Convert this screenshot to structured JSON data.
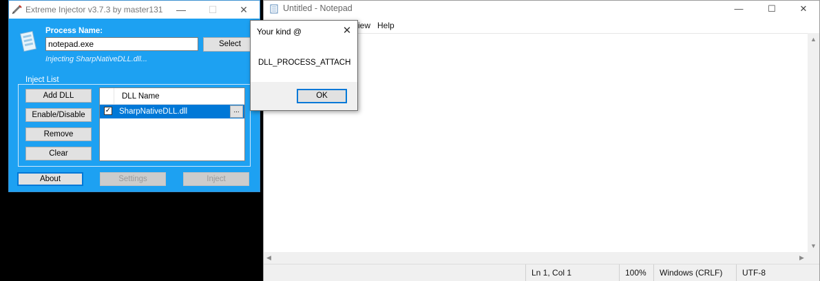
{
  "notepad": {
    "title": "Untitled - Notepad",
    "menu": {
      "view_partial": "iew",
      "help": "Help"
    },
    "controls": {
      "minimize": "—",
      "maximize": "☐",
      "close": "✕"
    },
    "status": {
      "position": "Ln 1, Col 1",
      "zoom": "100%",
      "line_ending": "Windows (CRLF)",
      "encoding": "UTF-8"
    }
  },
  "injector": {
    "title": "Extreme Injector v3.7.3 by master131",
    "controls": {
      "minimize": "—",
      "maximize": "☐",
      "close": "✕"
    },
    "process_label": "Process Name:",
    "process_value": "notepad.exe",
    "select_label": "Select",
    "status_text": "Injecting SharpNativeDLL.dll...",
    "inject_list_label": "Inject List",
    "buttons": {
      "add_dll": "Add DLL",
      "enable_disable": "Enable/Disable",
      "remove": "Remove",
      "clear": "Clear"
    },
    "list": {
      "column_header": "DLL Name",
      "rows": [
        {
          "name": "SharpNativeDLL.dll",
          "checked": true,
          "more_label": "..."
        }
      ]
    },
    "bottom": {
      "about": "About",
      "settings": "Settings",
      "inject": "Inject"
    },
    "accent_color": "#1da1f2"
  },
  "messagebox": {
    "title": "Your kind @",
    "close": "✕",
    "message": "DLL_PROCESS_ATTACH",
    "ok_label": "OK"
  }
}
